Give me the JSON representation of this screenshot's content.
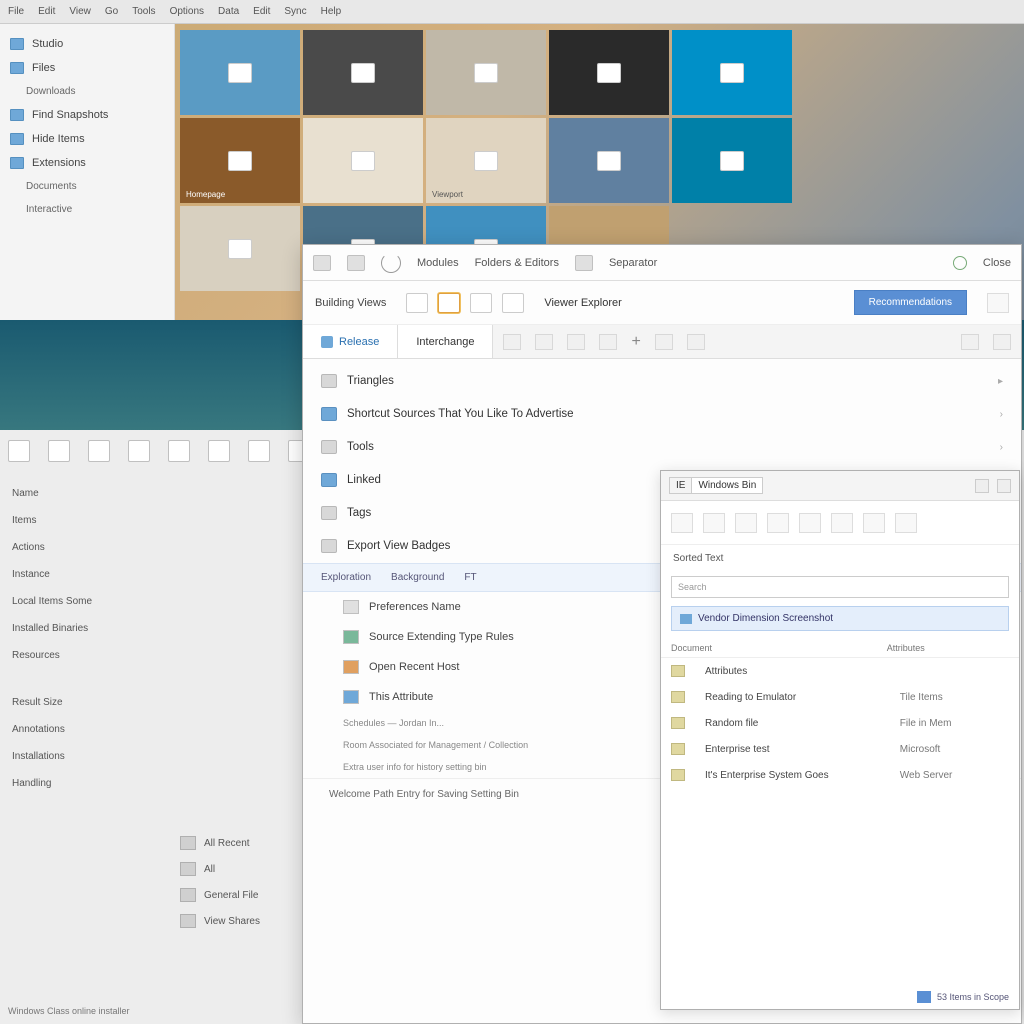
{
  "menubar": [
    "File",
    "Edit",
    "View",
    "Go",
    "Tools",
    "Options",
    "Data",
    "Edit",
    "Sync",
    "Help"
  ],
  "sidebar": {
    "items": [
      "Studio",
      "Files",
      "Downloads",
      "Find Snapshots",
      "Hide Items",
      "Extensions",
      "Documents",
      "Interactive"
    ]
  },
  "tiles": [
    {
      "c": "c0",
      "label": ""
    },
    {
      "c": "c1",
      "label": ""
    },
    {
      "c": "c2",
      "label": ""
    },
    {
      "c": "c3",
      "label": ""
    },
    {
      "c": "c4",
      "label": ""
    },
    {
      "c": "c5",
      "label": "Homepage"
    },
    {
      "c": "c6",
      "label": ""
    },
    {
      "c": "c7",
      "label": "Viewport"
    },
    {
      "c": "c8",
      "label": ""
    },
    {
      "c": "c9",
      "label": ""
    },
    {
      "c": "c10",
      "label": ""
    },
    {
      "c": "c11",
      "label": ""
    },
    {
      "c": "c12",
      "label": ""
    },
    {
      "c": "c13",
      "label": ""
    }
  ],
  "lower": {
    "col1": [
      "Name",
      "Items",
      "Actions",
      "Instance",
      "",
      "Local Items Some",
      "Installed Binaries",
      "Resources",
      "",
      "Result Size",
      "Annotations",
      "Installations",
      "Handling"
    ],
    "col2": [
      {
        "label": "All Recent"
      },
      {
        "label": "All"
      },
      {
        "label": "General File"
      },
      {
        "label": "View Shares"
      }
    ],
    "footer": "Windows Class online installer"
  },
  "winMain": {
    "titlebar": {
      "items": [
        "Modules",
        "Folders & Editors",
        "Separator",
        "Close"
      ]
    },
    "subbar": {
      "left": "Building Views",
      "mid": "Viewer Explorer",
      "button": "Recommendations"
    },
    "tabs": {
      "active": "Release",
      "second": "Interchange"
    },
    "list": [
      {
        "icon": "",
        "label": "Triangles",
        "chev": "▸"
      },
      {
        "icon": "blue",
        "label": "Shortcut Sources That You Like To Advertise",
        "chev": "›"
      },
      {
        "icon": "",
        "label": "Tools",
        "chev": "›"
      },
      {
        "icon": "blue",
        "label": "Linked"
      },
      {
        "icon": "",
        "label": "Tags"
      },
      {
        "icon": "",
        "label": "Export View Badges",
        "chev": "›"
      }
    ],
    "subhead": [
      "Exploration",
      "Background",
      "FT"
    ],
    "subitems": [
      {
        "label": "Preferences Name"
      },
      {
        "label": "Source Extending Type Rules",
        "icon": "green"
      },
      {
        "label": "Open Recent Host",
        "icon": "orange"
      },
      {
        "label": "This Attribute",
        "icon": "blue"
      }
    ],
    "notes": [
      "Schedules — Jordan In...",
      "Room Associated for Management / Collection",
      "Extra user info for history setting bin"
    ],
    "footrow": "Welcome Path Entry for Saving Setting Bin"
  },
  "winSec": {
    "tabs": [
      "IE",
      "Windows Bin"
    ],
    "header": "Sorted Text",
    "search": "Search",
    "selrow": "Vendor Dimension Screenshot",
    "cols": [
      "Document",
      "Attributes"
    ],
    "rows": [
      {
        "name": "Attributes",
        "type": ""
      },
      {
        "name": "Reading to Emulator",
        "type": "Tile Items"
      },
      {
        "name": "Random file",
        "type": "File in Mem"
      },
      {
        "name": "Enterprise test",
        "type": "Microsoft"
      },
      {
        "name": "It's Enterprise System Goes",
        "type": "Web Server"
      }
    ],
    "footer": "53 Items in Scope"
  }
}
